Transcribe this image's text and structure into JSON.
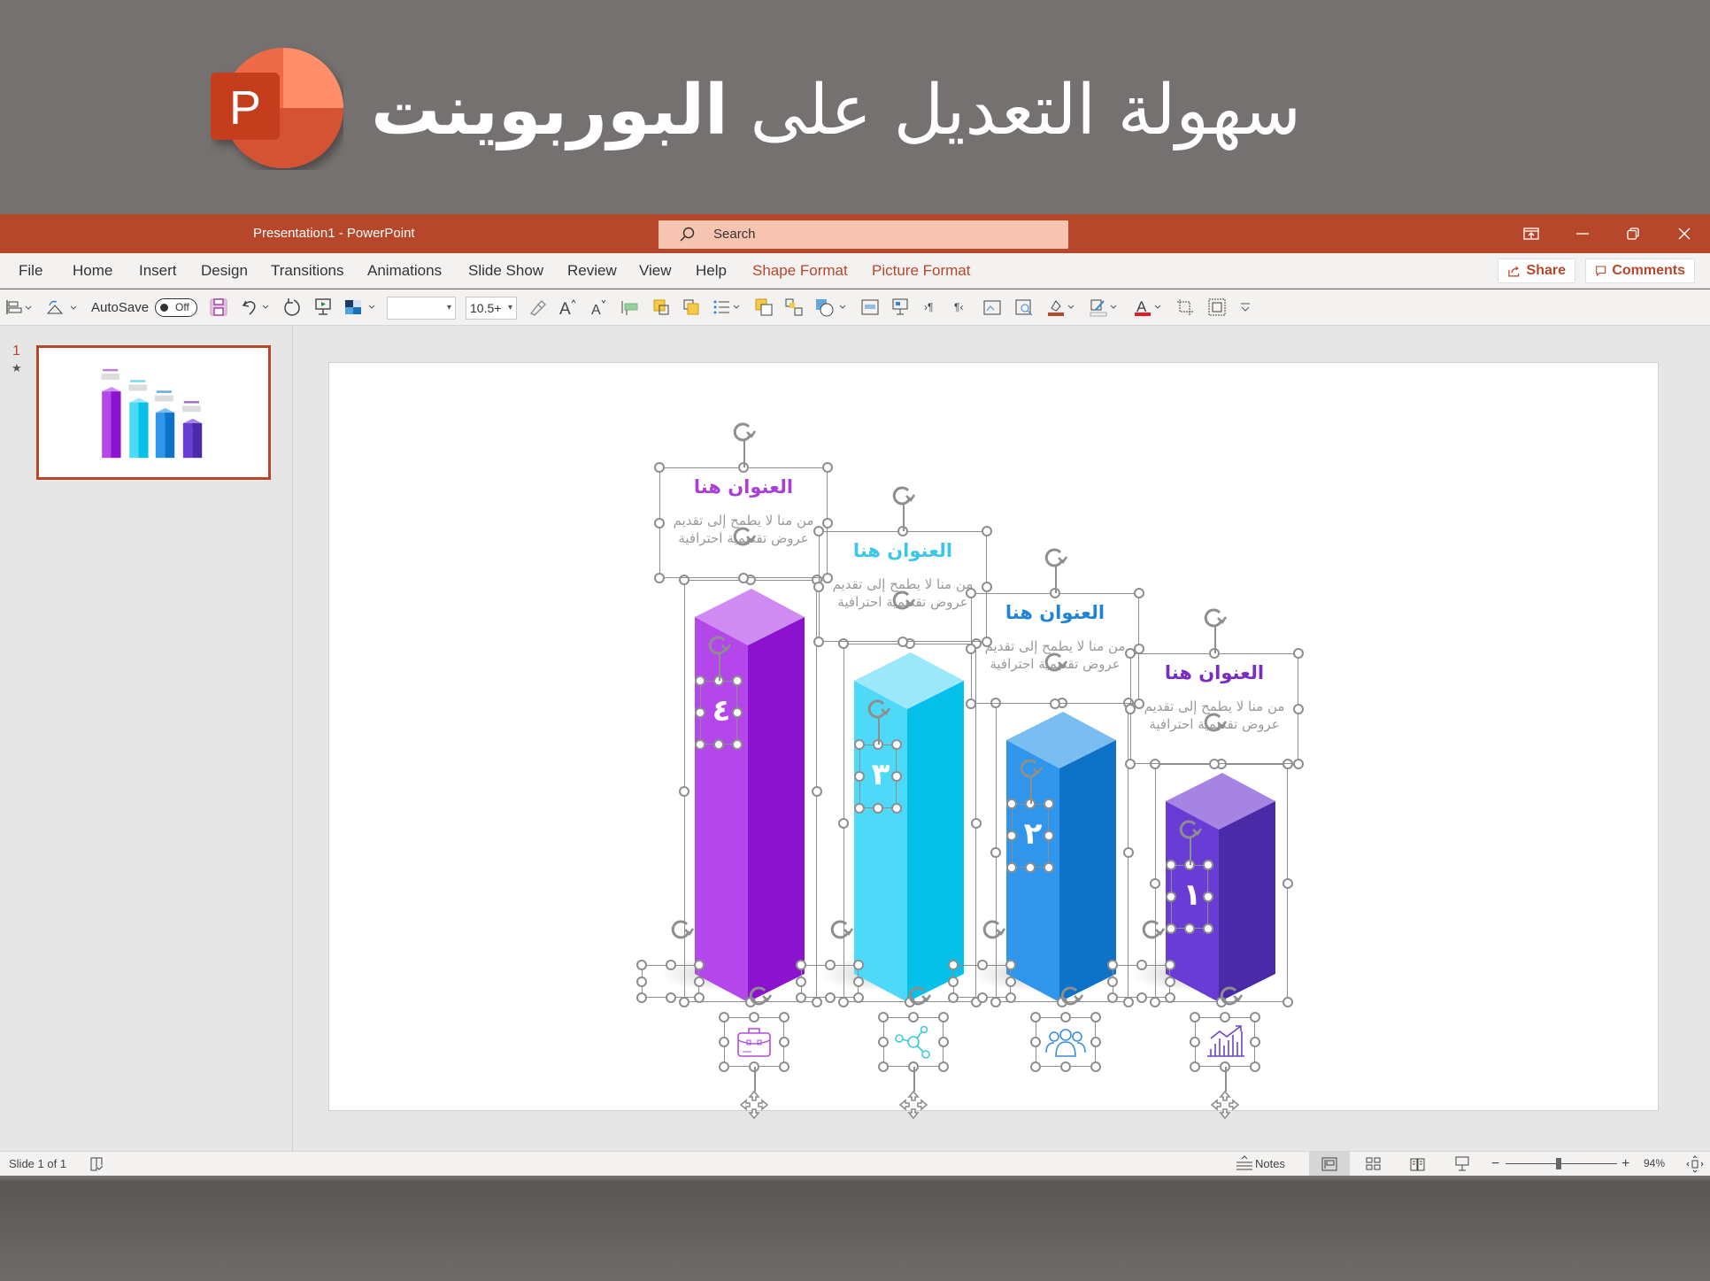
{
  "banner": {
    "title_regular": "سهولة التعديل على",
    "title_bold": "البوربوينت",
    "logo_letter": "P"
  },
  "window": {
    "title": "Presentation1  -  PowerPoint",
    "search_placeholder": "Search",
    "controls": [
      "ribbon-display-options",
      "minimize",
      "restore",
      "close"
    ]
  },
  "ribbon": {
    "tabs": [
      "File",
      "Home",
      "Insert",
      "Design",
      "Transitions",
      "Animations",
      "Slide Show",
      "Review",
      "View",
      "Help",
      "Shape Format",
      "Picture Format"
    ],
    "contextual_tabs": [
      "Shape Format",
      "Picture Format"
    ],
    "share_label": "Share",
    "comments_label": "Comments"
  },
  "toolbar": {
    "autosave_label": "AutoSave",
    "autosave_state": "Off",
    "font_name": "",
    "font_size": "10.5+"
  },
  "thumbnails": [
    {
      "number": "1",
      "has_animation": true,
      "selected": true
    }
  ],
  "slide": {
    "columns": [
      {
        "number": "٤",
        "title": "العنوان هنا",
        "body": "من منا لا يطمح إلى تقديم عروض تقديمية احترافية",
        "icon": "briefcase-icon",
        "title_color": "#A93FD9",
        "front_color": "#B347EA",
        "side_color": "#8B12CF",
        "top_color": "#CF8BF2",
        "icon_color": "#B04BE0",
        "height_rank": 4
      },
      {
        "number": "٣",
        "title": "العنوان هنا",
        "body": "من منا لا يطمح إلى تقديم عروض تقديمية احترافية",
        "icon": "network-icon",
        "title_color": "#3CC7EA",
        "front_color": "#4DD9F7",
        "side_color": "#05C0E8",
        "top_color": "#9AE8FA",
        "icon_color": "#3CC9E0",
        "height_rank": 3
      },
      {
        "number": "٢",
        "title": "العنوان هنا",
        "body": "من منا لا يطمح إلى تقديم عروض تقديمية احترافية",
        "icon": "team-icon",
        "title_color": "#2183D6",
        "front_color": "#2F96EC",
        "side_color": "#0E72C8",
        "top_color": "#7ABEF1",
        "icon_color": "#3C8EE0",
        "height_rank": 2
      },
      {
        "number": "١",
        "title": "العنوان هنا",
        "body": "من منا لا يطمح إلى تقديم عروض تقديمية احترافية",
        "icon": "growth-chart-icon",
        "title_color": "#7B2CBF",
        "front_color": "#6A3CD6",
        "side_color": "#4B2AA8",
        "top_color": "#A584E4",
        "icon_color": "#6B44C8",
        "height_rank": 1
      }
    ]
  },
  "status": {
    "slide_info": "Slide 1 of 1",
    "notes_label": "Notes",
    "zoom_percent": "94%",
    "zoom_level": 0.94
  },
  "colors": {
    "accent": "#B7472A",
    "search_bg": "#F8C4B2",
    "banner_bg": "#767171"
  }
}
